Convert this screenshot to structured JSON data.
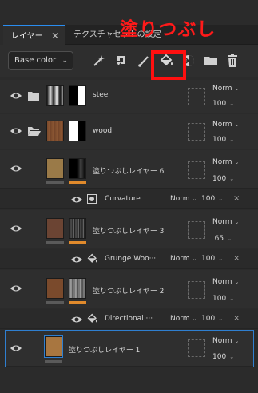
{
  "tabs": [
    {
      "label": "レイヤー",
      "active": true
    },
    {
      "label": "テクスチャセットの設定",
      "active": false
    }
  ],
  "annotation": "塗りつぶし",
  "toolbar": {
    "channel": "Base color",
    "icons": [
      "magic-wand-icon",
      "rotate-paint-icon",
      "brush-icon",
      "fill-bucket-icon",
      "mask-icon",
      "folder-icon",
      "trash-icon"
    ]
  },
  "layers": [
    {
      "name": "steel",
      "blend": "Norm",
      "opacity": "100",
      "type": "folder"
    },
    {
      "name": "wood",
      "blend": "Norm",
      "opacity": "100",
      "type": "folder-open"
    },
    {
      "name": "塗りつぶしレイヤー 6",
      "blend": "Norm",
      "opacity": "100",
      "type": "fill",
      "effect": {
        "name": "Curvature",
        "blend": "Norm",
        "opacity": "100"
      }
    },
    {
      "name": "塗りつぶしレイヤー 3",
      "blend": "Norm",
      "opacity": "65",
      "type": "fill",
      "effect": {
        "name": "Grunge Woo···",
        "blend": "Norm",
        "opacity": "100"
      }
    },
    {
      "name": "塗りつぶしレイヤー 2",
      "blend": "Norm",
      "opacity": "100",
      "type": "fill",
      "effect": {
        "name": "Directional ···",
        "blend": "Norm",
        "opacity": "100"
      }
    },
    {
      "name": "塗りつぶしレイヤー 1",
      "blend": "Norm",
      "opacity": "100",
      "type": "fill",
      "selected": true
    }
  ],
  "colors": {
    "accent": "#2a8df0",
    "highlight": "#ff1010",
    "wood": "#7b4a2c",
    "tan": "#a07a44",
    "orange_bar": "#e08a2c"
  }
}
